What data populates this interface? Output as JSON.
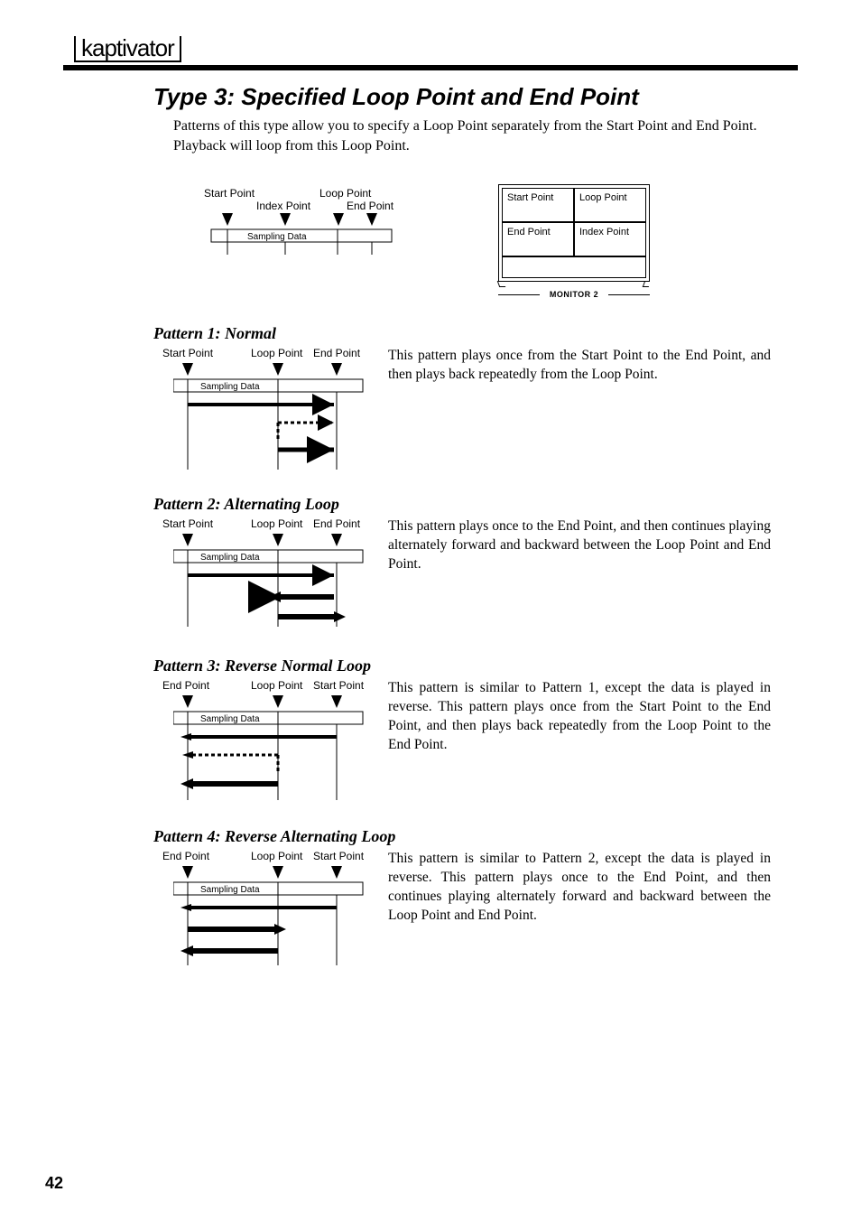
{
  "header": {
    "logo": "kaptivator"
  },
  "page_number": "42",
  "section": {
    "title": "Type 3: Specified Loop Point and End Point",
    "intro": "Patterns of this type allow you to specify a Loop Point separately from the Start Point and End Point. Playback will loop from this Loop Point."
  },
  "monitor": {
    "cells": [
      "Start Point",
      "Loop Point",
      "End Point",
      "Index Point"
    ],
    "caption": "MONITOR 2"
  },
  "top_diagram": {
    "labels_top": [
      "Start Point",
      "Loop Point"
    ],
    "labels_mid": [
      "Index Point",
      "End Point"
    ],
    "bar_label": "Sampling Data"
  },
  "patterns": [
    {
      "title": "Pattern 1: Normal",
      "labels": [
        "Start Point",
        "Loop Point",
        "End Point"
      ],
      "bar_label": "Sampling Data",
      "desc": "This pattern plays once from the Start Point to the End Point, and then plays back repeatedly from the Loop Point."
    },
    {
      "title": "Pattern 2: Alternating Loop",
      "labels": [
        "Start Point",
        "Loop Point",
        "End Point"
      ],
      "bar_label": "Sampling Data",
      "desc": "This pattern plays once to the End Point, and then continues playing alternately forward and backward between the Loop Point and End Point."
    },
    {
      "title": "Pattern 3: Reverse Normal Loop",
      "labels": [
        "End Point",
        "Loop Point",
        "Start Point"
      ],
      "bar_label": "Sampling Data",
      "desc": "This pattern is similar to Pattern 1, except the data is played in reverse. This pattern plays once from the Start Point to the End Point, and then plays back repeatedly from the Loop Point to the End Point."
    },
    {
      "title": "Pattern 4: Reverse Alternating Loop",
      "labels": [
        "End Point",
        "Loop Point",
        "Start Point"
      ],
      "bar_label": "Sampling Data",
      "desc": "This pattern is similar to Pattern 2, except the data is played in reverse. This pattern plays once to the End Point, and then continues playing alternately forward and backward between the Loop Point and End Point."
    }
  ]
}
